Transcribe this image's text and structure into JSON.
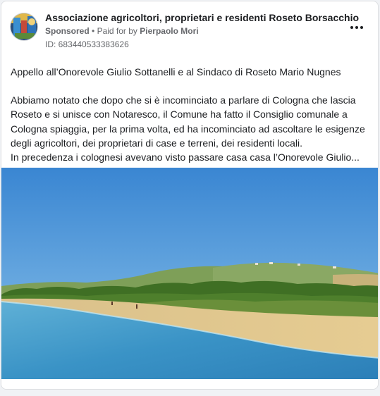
{
  "post": {
    "page_name": "Associazione agricoltori, proprietari e residenti Roseto Borsacchio",
    "sponsored_label": "Sponsored",
    "paid_for_prefix": "Paid for by",
    "payer_name": "Pierpaolo Mori",
    "ad_id": "ID: 683440533383626",
    "text_lines": [
      "Appello all’Onorevole Giulio Sottanelli e al Sindaco di Roseto Mario Nugnes",
      "Abbiamo notato che dopo che si è incominciato a parlare di Cologna che lascia",
      "Roseto e si unisce con Notaresco, il Comune ha fatto il Consiglio comunale a",
      "Cologna spiaggia, per la prima volta, ed ha incominciato ad ascoltare le esigenze",
      "degli agricoltori, dei proprietari di case e terreni, dei residenti locali.",
      "In precedenza i colognesi avevano visto passare casa casa l’Onorevole Giulio..."
    ]
  },
  "icons": {
    "more": "more-horizontal-icon",
    "avatar": "page-avatar-icon"
  },
  "colors": {
    "sky": "#3f8fd6",
    "sea": "#2d8fc4",
    "sand": "#e3c88c",
    "hills": "#6f9a3a",
    "text": "#1c1e21",
    "muted": "#65676b"
  }
}
